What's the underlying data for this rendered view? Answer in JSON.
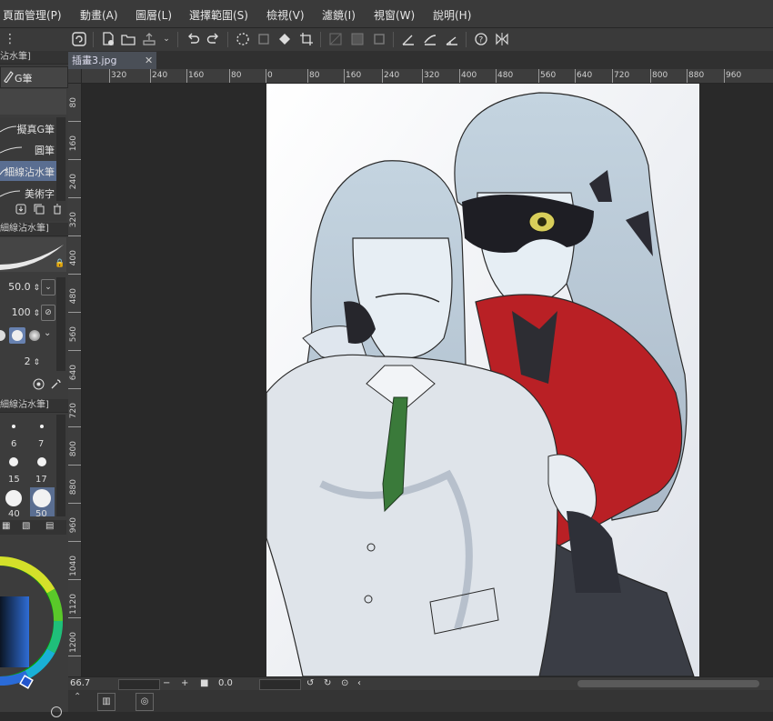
{
  "menubar": {
    "items": [
      "頁面管理(P)",
      "動畫(A)",
      "圖層(L)",
      "選擇範圍(S)",
      "檢視(V)",
      "濾鏡(I)",
      "視窗(W)",
      "說明(H)"
    ]
  },
  "document": {
    "tab_title": "插畫3.jpg"
  },
  "left_panel": {
    "sub_tool_title": "沾水筆]",
    "current_tool": "G筆",
    "brushes": [
      "擬真G筆",
      "圓筆",
      "細線沾水筆",
      "美術字"
    ],
    "tool_property_title": "細線沾水筆]",
    "brush_size": "50.0",
    "opacity": "100",
    "stabilization": "2",
    "brush_size_panel_title": "細線沾水筆]",
    "size_presets": [
      "6",
      "7",
      "15",
      "17",
      "40",
      "50"
    ]
  },
  "ruler": {
    "top_labels": [
      "320",
      "240",
      "160",
      "80",
      "0",
      "80",
      "160",
      "240",
      "320",
      "400",
      "480",
      "560",
      "640",
      "720",
      "800",
      "880",
      "960"
    ],
    "left_labels": [
      "80",
      "160",
      "240",
      "320",
      "400",
      "480",
      "560",
      "640",
      "720",
      "800",
      "880",
      "960",
      "1040",
      "1120",
      "1200"
    ]
  },
  "status": {
    "zoom": "66.7",
    "rotation": "0.0"
  },
  "colors": {
    "accent": "#5f7aa8",
    "selected_brush_bg": "#5a6e91",
    "panel_bg": "#3c3c3c",
    "canvas_bg": "#292929"
  }
}
